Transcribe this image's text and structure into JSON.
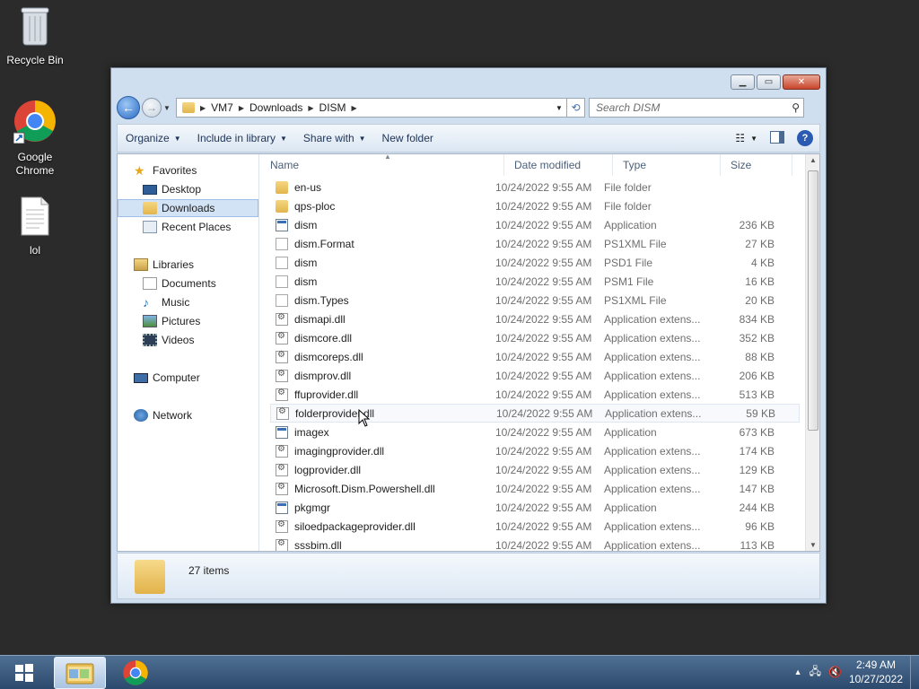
{
  "desktop": {
    "icons": [
      {
        "label": "Recycle Bin"
      },
      {
        "label": "Google Chrome"
      },
      {
        "label": "lol"
      }
    ]
  },
  "address": {
    "segments": [
      "VM7",
      "Downloads",
      "DISM"
    ],
    "search_placeholder": "Search DISM"
  },
  "toolbar": {
    "organize": "Organize",
    "include_in_library": "Include in library",
    "share_with": "Share with",
    "new_folder": "New folder"
  },
  "nav": {
    "favorites": "Favorites",
    "desktop": "Desktop",
    "downloads": "Downloads",
    "recent_places": "Recent Places",
    "libraries": "Libraries",
    "documents": "Documents",
    "music": "Music",
    "pictures": "Pictures",
    "videos": "Videos",
    "computer": "Computer",
    "network": "Network"
  },
  "columns": {
    "name": "Name",
    "date": "Date modified",
    "type": "Type",
    "size": "Size"
  },
  "files": [
    {
      "name": "en-us",
      "date": "10/24/2022 9:55 AM",
      "type": "File folder",
      "size": "",
      "icon": "folder"
    },
    {
      "name": "qps-ploc",
      "date": "10/24/2022 9:55 AM",
      "type": "File folder",
      "size": "",
      "icon": "folder"
    },
    {
      "name": "dism",
      "date": "10/24/2022 9:55 AM",
      "type": "Application",
      "size": "236 KB",
      "icon": "app"
    },
    {
      "name": "dism.Format",
      "date": "10/24/2022 9:55 AM",
      "type": "PS1XML File",
      "size": "27 KB",
      "icon": "doc"
    },
    {
      "name": "dism",
      "date": "10/24/2022 9:55 AM",
      "type": "PSD1 File",
      "size": "4 KB",
      "icon": "doc"
    },
    {
      "name": "dism",
      "date": "10/24/2022 9:55 AM",
      "type": "PSM1 File",
      "size": "16 KB",
      "icon": "doc"
    },
    {
      "name": "dism.Types",
      "date": "10/24/2022 9:55 AM",
      "type": "PS1XML File",
      "size": "20 KB",
      "icon": "doc"
    },
    {
      "name": "dismapi.dll",
      "date": "10/24/2022 9:55 AM",
      "type": "Application extens...",
      "size": "834 KB",
      "icon": "dll"
    },
    {
      "name": "dismcore.dll",
      "date": "10/24/2022 9:55 AM",
      "type": "Application extens...",
      "size": "352 KB",
      "icon": "dll"
    },
    {
      "name": "dismcoreps.dll",
      "date": "10/24/2022 9:55 AM",
      "type": "Application extens...",
      "size": "88 KB",
      "icon": "dll"
    },
    {
      "name": "dismprov.dll",
      "date": "10/24/2022 9:55 AM",
      "type": "Application extens...",
      "size": "206 KB",
      "icon": "dll"
    },
    {
      "name": "ffuprovider.dll",
      "date": "10/24/2022 9:55 AM",
      "type": "Application extens...",
      "size": "513 KB",
      "icon": "dll"
    },
    {
      "name": "folderprovider.dll",
      "date": "10/24/2022 9:55 AM",
      "type": "Application extens...",
      "size": "59 KB",
      "icon": "dll"
    },
    {
      "name": "imagex",
      "date": "10/24/2022 9:55 AM",
      "type": "Application",
      "size": "673 KB",
      "icon": "app"
    },
    {
      "name": "imagingprovider.dll",
      "date": "10/24/2022 9:55 AM",
      "type": "Application extens...",
      "size": "174 KB",
      "icon": "dll"
    },
    {
      "name": "logprovider.dll",
      "date": "10/24/2022 9:55 AM",
      "type": "Application extens...",
      "size": "129 KB",
      "icon": "dll"
    },
    {
      "name": "Microsoft.Dism.Powershell.dll",
      "date": "10/24/2022 9:55 AM",
      "type": "Application extens...",
      "size": "147 KB",
      "icon": "dll"
    },
    {
      "name": "pkgmgr",
      "date": "10/24/2022 9:55 AM",
      "type": "Application",
      "size": "244 KB",
      "icon": "app"
    },
    {
      "name": "siloedpackageprovider.dll",
      "date": "10/24/2022 9:55 AM",
      "type": "Application extens...",
      "size": "96 KB",
      "icon": "dll"
    },
    {
      "name": "sssbim.dll",
      "date": "10/24/2022 9:55 AM",
      "type": "Application extens...",
      "size": "113 KB",
      "icon": "dll"
    }
  ],
  "details": {
    "count": "27 items"
  },
  "taskbar": {
    "time": "2:49 AM",
    "date": "10/27/2022"
  }
}
